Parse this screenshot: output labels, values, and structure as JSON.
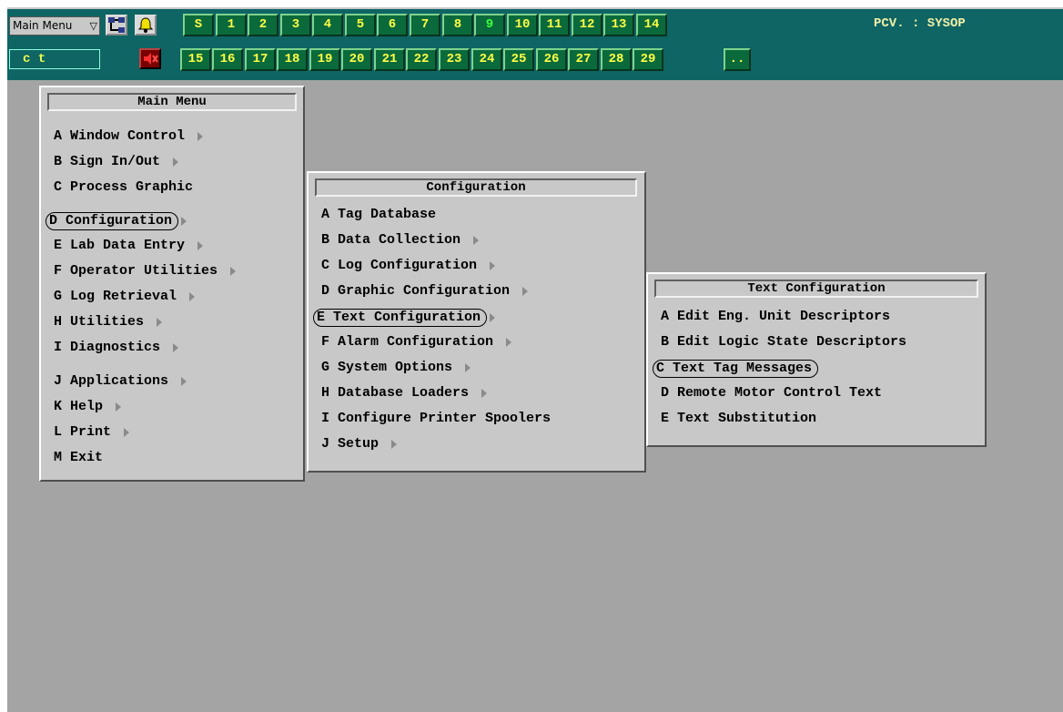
{
  "toolbar": {
    "menu_select_value": "Main Menu",
    "ct_field_value": "c  t",
    "status": "PCV. : SYSOP",
    "row1_buttons": [
      "S",
      "1",
      "2",
      "3",
      "4",
      "5",
      "6",
      "7",
      "8",
      "9",
      "10",
      "11",
      "12",
      "13",
      "14"
    ],
    "row2_buttons": [
      "15",
      "16",
      "17",
      "18",
      "19",
      "20",
      "21",
      "22",
      "23",
      "24",
      "25",
      "26",
      "27",
      "28",
      "29",
      ".."
    ],
    "icons": [
      "network-icon",
      "bell-icon",
      "speaker-silence-icon"
    ],
    "colors": {
      "toolbar_bg": "#0f6464",
      "button_bg": "#0b6a3c",
      "button_text": "#ffff44",
      "button9_text": "#3cff3c"
    }
  },
  "main_menu": {
    "title": "Main Menu",
    "items": [
      {
        "label": "A Window Control",
        "submenu": true
      },
      {
        "label": "B Sign In/Out",
        "submenu": true
      },
      {
        "label": "C Process Graphic",
        "submenu": false
      },
      {
        "label": "D Configuration",
        "submenu": true,
        "selected": true
      },
      {
        "label": "E Lab Data Entry",
        "submenu": true
      },
      {
        "label": "F Operator Utilities",
        "submenu": true
      },
      {
        "label": "G Log Retrieval",
        "submenu": true
      },
      {
        "label": "H Utilities",
        "submenu": true
      },
      {
        "label": "I Diagnostics",
        "submenu": true
      },
      {
        "label": "J Applications",
        "submenu": true
      },
      {
        "label": "K Help",
        "submenu": true
      },
      {
        "label": "L Print",
        "submenu": true
      },
      {
        "label": "M Exit",
        "submenu": false
      }
    ]
  },
  "config_menu": {
    "title": "Configuration",
    "items": [
      {
        "label": "A Tag Database",
        "submenu": false
      },
      {
        "label": "B Data Collection",
        "submenu": true
      },
      {
        "label": "C Log Configuration",
        "submenu": true
      },
      {
        "label": "D Graphic Configuration",
        "submenu": true
      },
      {
        "label": "E Text Configuration",
        "submenu": true,
        "selected": true
      },
      {
        "label": "F Alarm Configuration",
        "submenu": true
      },
      {
        "label": "G System Options",
        "submenu": true
      },
      {
        "label": "H Database Loaders",
        "submenu": true
      },
      {
        "label": "I Configure Printer Spoolers",
        "submenu": false
      },
      {
        "label": "J Setup",
        "submenu": true
      }
    ]
  },
  "text_menu": {
    "title": "Text Configuration",
    "items": [
      {
        "label": "A Edit Eng. Unit Descriptors",
        "submenu": false
      },
      {
        "label": "B Edit Logic State Descriptors",
        "submenu": false
      },
      {
        "label": "C Text Tag Messages",
        "submenu": false,
        "selected": true
      },
      {
        "label": "D Remote Motor Control Text",
        "submenu": false
      },
      {
        "label": "E Text Substitution",
        "submenu": false
      }
    ]
  }
}
